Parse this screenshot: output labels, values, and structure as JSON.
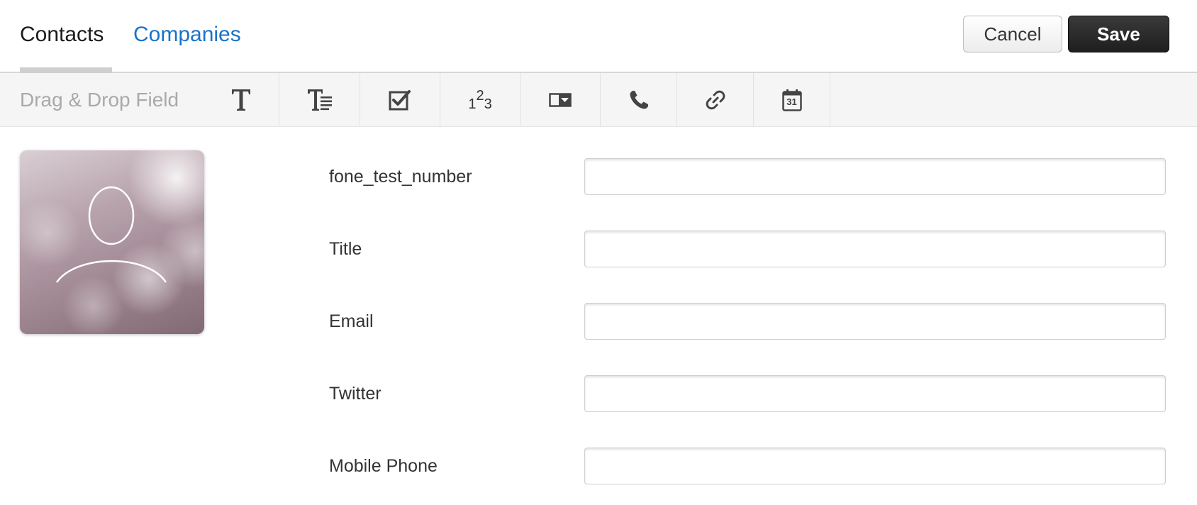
{
  "header": {
    "tabs": [
      {
        "label": "Contacts",
        "active": true
      },
      {
        "label": "Companies",
        "active": false
      }
    ],
    "cancel_label": "Cancel",
    "save_label": "Save"
  },
  "toolbar": {
    "label": "Drag & Drop Field",
    "tools": [
      {
        "icon": "text-field-icon"
      },
      {
        "icon": "paragraph-field-icon"
      },
      {
        "icon": "checkbox-field-icon"
      },
      {
        "icon": "number-field-icon",
        "text": "123"
      },
      {
        "icon": "dropdown-field-icon"
      },
      {
        "icon": "phone-field-icon"
      },
      {
        "icon": "link-field-icon"
      },
      {
        "icon": "date-field-icon",
        "text": "31"
      }
    ]
  },
  "avatar": {
    "icon": "person-silhouette-icon"
  },
  "fields": [
    {
      "label": "fone_test_number",
      "value": "",
      "placeholder": ""
    },
    {
      "label": "Title",
      "value": "",
      "placeholder": ""
    },
    {
      "label": "Email",
      "value": "",
      "placeholder": ""
    },
    {
      "label": "Twitter",
      "value": "",
      "placeholder": ""
    },
    {
      "label": "Mobile Phone",
      "value": "",
      "placeholder": ""
    }
  ],
  "colors": {
    "link_blue": "#1a73c9",
    "save_button_bg": "#262626",
    "toolbar_bg": "#f5f5f5",
    "muted_text": "#a9a9a9"
  }
}
